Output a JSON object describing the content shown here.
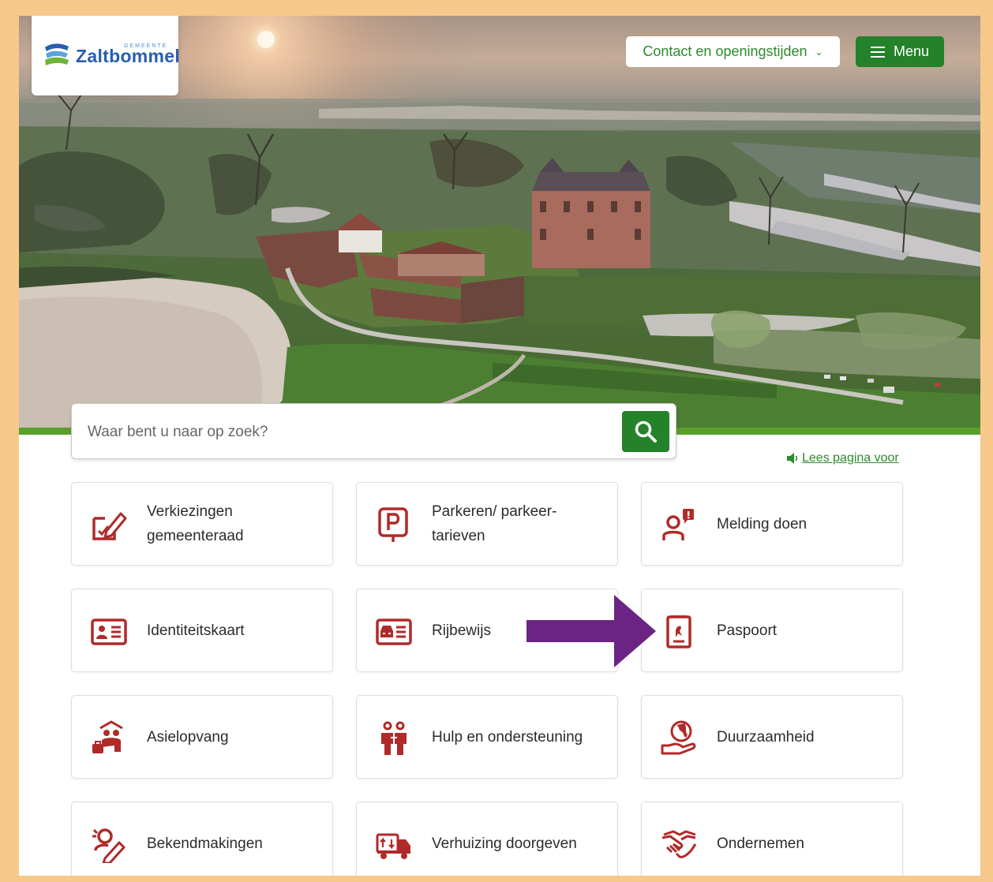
{
  "header": {
    "logo_text": "Zaltbommel",
    "logo_subtext": "GEMEENTE",
    "contact_label": "Contact en openingstijden",
    "menu_label": "Menu"
  },
  "search": {
    "placeholder": "Waar bent u naar op zoek?"
  },
  "read_aloud_label": "Lees pagina voor",
  "tiles": [
    {
      "label": "Verkiezingen gemeenteraad",
      "icon": "ballot-pen-icon"
    },
    {
      "label": "Parkeren/ parkeer-tarieven",
      "icon": "parking-icon"
    },
    {
      "label": "Melding doen",
      "icon": "report-person-icon"
    },
    {
      "label": "Identiteitskaart",
      "icon": "id-card-icon"
    },
    {
      "label": "Rijbewijs",
      "icon": "driving-license-icon"
    },
    {
      "label": "Paspoort",
      "icon": "passport-icon"
    },
    {
      "label": "Asielopvang",
      "icon": "asylum-icon"
    },
    {
      "label": "Hulp en ondersteuning",
      "icon": "support-people-icon"
    },
    {
      "label": "Duurzaamheid",
      "icon": "globe-hand-icon"
    },
    {
      "label": "Bekendmakingen",
      "icon": "announcement-icon"
    },
    {
      "label": "Verhuizing doorgeven",
      "icon": "moving-truck-icon"
    },
    {
      "label": "Ondernemen",
      "icon": "handshake-icon"
    }
  ],
  "colors": {
    "accent_green": "#23822a",
    "icon_red": "#b02a2a",
    "annotation_arrow": "#6b2484",
    "outer_background": "#f6c98a"
  }
}
